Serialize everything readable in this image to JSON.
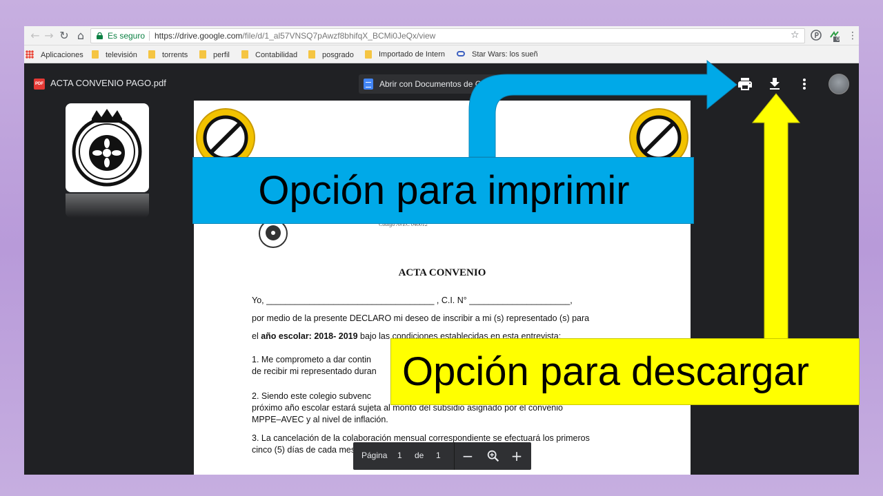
{
  "browser": {
    "secure_label": "Es seguro",
    "url_base": "https://drive.google.com",
    "url_path": "/file/d/1_al57VNSQ7pAwzf8bhifqX_BCMi0JeQx/view",
    "extension_badge": "0"
  },
  "bookmarks": [
    "Aplicaciones",
    "televisión",
    "torrents",
    "perfil",
    "Contabilidad",
    "posgrado",
    "Importado de Intern",
    "Star Wars: los sueñ"
  ],
  "viewer": {
    "file_badge": "PDF",
    "file_title": "ACTA CONVENIO PAGO.pdf",
    "open_with_label": "Abrir con Documentos de Go"
  },
  "document": {
    "codigo": "Código AVEC 040012",
    "title": "ACTA CONVENIO",
    "line_yo": "Yo, ___________________________________ , C.I. N° _____________________,",
    "line_declaro": "por medio de la presente DECLARO mi deseo de inscribir a mi (s) representado (s) para",
    "line_anio_prefix": "el ",
    "line_anio_bold": "año escolar: 2018- 2019",
    "line_anio_suffix": "  bajo las condiciones establecidas en esta entrevista:",
    "p1_a": "1. Me comprometo a dar contin",
    "p1_b": "de recibir mi representado duran",
    "p2_a": "2. Siendo este colegio subvenc",
    "p2_b": "próximo año escolar estará sujeta al monto del subsidio asignado por el convenio",
    "p2_c": "MPPE–AVEC y al  nivel de inflación.",
    "p3_a": "3. La cancelación de la colaboración mensual correspondiente se efectuará los primeros",
    "p3_b": "cinco (5) días de cada mes."
  },
  "page_control": {
    "label": "Página",
    "current": "1",
    "of": "de",
    "total": "1"
  },
  "callouts": {
    "print": "Opción para imprimir",
    "download": "Opción para descargar"
  },
  "colors": {
    "blue_callout": "#00a9e8",
    "yellow_callout": "#ffff00",
    "background": "#b89ad9"
  }
}
